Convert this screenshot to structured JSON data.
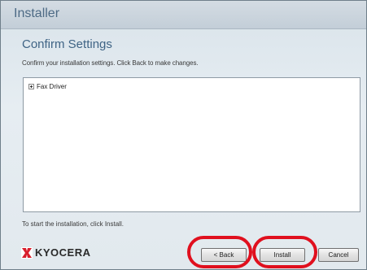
{
  "window": {
    "title": "Installer"
  },
  "page": {
    "heading": "Confirm Settings",
    "instruction": "Confirm your installation settings. Click Back to make changes."
  },
  "tree": {
    "items": [
      {
        "label": "Fax Driver",
        "expander": "plus-expander-icon"
      }
    ]
  },
  "footer": {
    "hint": "To start the installation, click Install.",
    "logo_text": "KYOCERA"
  },
  "buttons": {
    "back_label": "< Back",
    "install_label": "Install",
    "cancel_label": "Cancel"
  },
  "annotations": {
    "highlight_color": "#e0101e",
    "highlighted": [
      "Back",
      "Install"
    ]
  },
  "colors": {
    "brand_red": "#d81e2c",
    "heading_blue": "#3f6485"
  }
}
